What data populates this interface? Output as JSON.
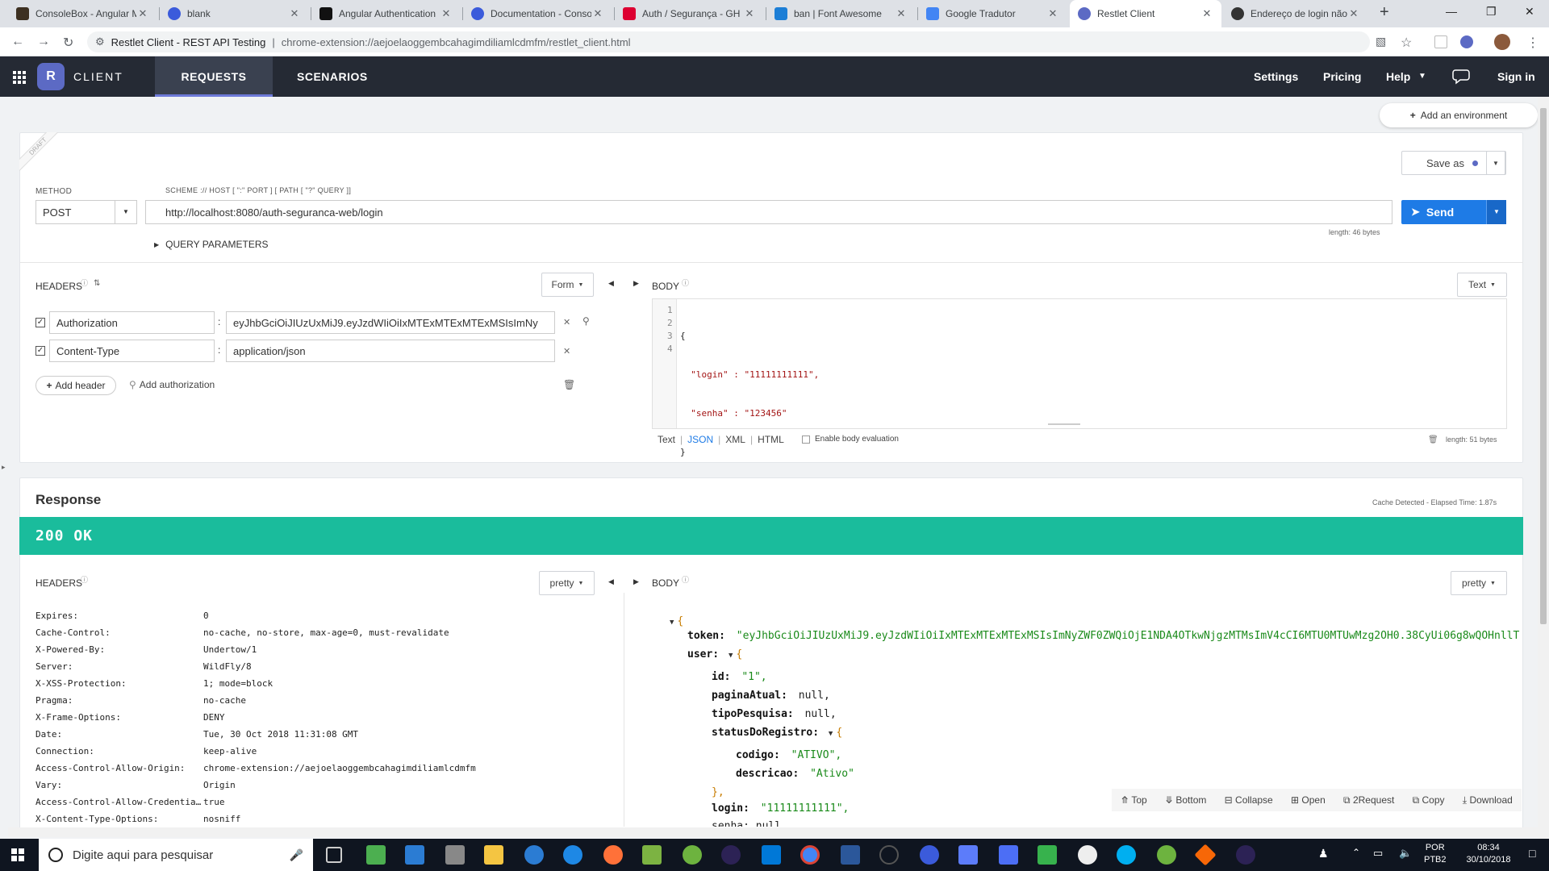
{
  "browser": {
    "tabs": [
      {
        "title": "ConsoleBox - Angular M",
        "color": "#3d3021"
      },
      {
        "title": "blank",
        "color": "#3b5bdb"
      },
      {
        "title": "Angular Authentication",
        "color": "#111111"
      },
      {
        "title": "Documentation - Conso",
        "color": "#3b5bdb"
      },
      {
        "title": "Auth / Segurança - GH",
        "color": "#dd0031"
      },
      {
        "title": "ban | Font Awesome",
        "color": "#1c7ed6"
      },
      {
        "title": "Google Tradutor",
        "color": "#4285f4"
      },
      {
        "title": "Restlet Client",
        "color": "#5c6ac4"
      },
      {
        "title": "Endereço de login não",
        "color": "#333333"
      }
    ],
    "address_site": "Restlet Client - REST API Testing",
    "address_url": "chrome-extension://aejoelaoggembcahagimdiliamlcdmfm/restlet_client.html"
  },
  "app": {
    "brand": "CLIENT",
    "logo_letter": "R",
    "nav_requests": "REQUESTS",
    "nav_scenarios": "SCENARIOS",
    "settings": "Settings",
    "pricing": "Pricing",
    "help": "Help",
    "signin": "Sign in",
    "add_environment": "Add an environment"
  },
  "request": {
    "draft": "DRAFT",
    "save_as": "Save as",
    "method_label": "METHOD",
    "method": "POST",
    "url_label": "SCHEME :// HOST [ \":\" PORT ] [ PATH [ \"?\" QUERY ]]",
    "url": "http://localhost:8080/auth-seguranca-web/login",
    "url_length": "length: 46 bytes",
    "send": "Send",
    "query_params": "QUERY PARAMETERS",
    "headers_title": "HEADERS",
    "form_btn": "Form",
    "headers": [
      {
        "name": "Authorization",
        "value": "eyJhbGciOiJIUzUxMiJ9.eyJzdWIiOiIxMTExMTExMTExMSIsImNy"
      },
      {
        "name": "Content-Type",
        "value": "application/json"
      }
    ],
    "add_header": "Add header",
    "add_authorization": "Add authorization",
    "body_title": "BODY",
    "body_type": "Text",
    "body_lines": [
      "{",
      "  \"login\" : \"11111111111\",",
      "  \"senha\" : \"123456\"",
      "}"
    ],
    "line_numbers": [
      "1",
      "2",
      "3",
      "4"
    ],
    "body_formats": [
      "Text",
      "JSON",
      "XML",
      "HTML"
    ],
    "enable_eval": "Enable body evaluation",
    "body_length": "length: 51 bytes"
  },
  "response": {
    "title": "Response",
    "cache_info": "Cache Detected - Elapsed Time: 1.87s",
    "status": "200 OK",
    "status_color": "#1abc9c",
    "headers_title": "HEADERS",
    "pretty": "pretty",
    "body_title": "BODY",
    "headers": [
      {
        "k": "Expires:",
        "v": "0"
      },
      {
        "k": "Cache-Control:",
        "v": "no-cache, no-store, max-age=0, must-revalidate"
      },
      {
        "k": "X-Powered-By:",
        "v": "Undertow/1"
      },
      {
        "k": "Server:",
        "v": "WildFly/8"
      },
      {
        "k": "X-XSS-Protection:",
        "v": "1; mode=block"
      },
      {
        "k": "Pragma:",
        "v": "no-cache"
      },
      {
        "k": "X-Frame-Options:",
        "v": "DENY"
      },
      {
        "k": "Date:",
        "v": "Tue, 30 Oct 2018 11:31:08 GMT"
      },
      {
        "k": "Connection:",
        "v": "keep-alive"
      },
      {
        "k": "Access-Control-Allow-Origin:",
        "v": "chrome-extension://aejoelaoggembcahagimdiliamlcdmfm"
      },
      {
        "k": "Vary:",
        "v": "Origin"
      },
      {
        "k": "Access-Control-Allow-Credentia…",
        "v": "true"
      },
      {
        "k": "X-Content-Type-Options:",
        "v": "nosniff"
      }
    ],
    "json": {
      "token_key": "token:",
      "token_val": "\"eyJhbGciOiJIUzUxMiJ9.eyJzdWIiOiIxMTExMTExMTExMSIsImNyZWF0ZWQiOjE1NDA4OTkwNjgzMTMsImV4cCI6MTU0MTUwMzg2OH0.38CyUi06g8wQOHnllT",
      "user_key": "user:",
      "id_key": "id:",
      "id_val": "\"1\",",
      "pagina_key": "paginaAtual:",
      "pagina_val": "null,",
      "tipo_key": "tipoPesquisa:",
      "tipo_val": "null,",
      "status_key": "statusDoRegistro:",
      "codigo_key": "codigo:",
      "codigo_val": "\"ATIVO\",",
      "descricao_key": "descricao:",
      "descricao_val": "\"Ativo\"",
      "close_obj": "},",
      "login_key": "login:",
      "login_val": "\"11111111111\",",
      "senha_partial": "senha:  null"
    },
    "toolbar": [
      "Top",
      "Bottom",
      "Collapse",
      "Open",
      "2Request",
      "Copy",
      "Download"
    ]
  },
  "taskbar": {
    "search_placeholder": "Digite aqui para pesquisar",
    "lang1": "POR",
    "lang2": "PTB2",
    "time": "08:34",
    "date": "30/10/2018"
  }
}
